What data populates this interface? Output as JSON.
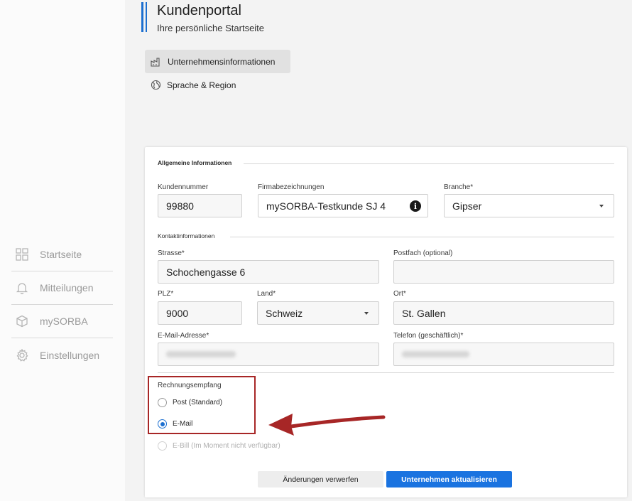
{
  "sidebar": {
    "items": [
      {
        "label": "Startseite",
        "icon": "dashboard-icon"
      },
      {
        "label": "Mitteilungen",
        "icon": "bell-icon"
      },
      {
        "label": "mySORBA",
        "icon": "cube-icon"
      },
      {
        "label": "Einstellungen",
        "icon": "gear-icon"
      }
    ]
  },
  "header": {
    "title": "Kundenportal",
    "subtitle": "Ihre persönliche Startseite"
  },
  "subnav": {
    "items": [
      {
        "label": "Unternehmensinformationen",
        "icon": "factory-icon",
        "active": true
      },
      {
        "label": "Sprache & Region",
        "icon": "globe-icon",
        "active": false
      }
    ]
  },
  "form": {
    "general_section": "Allgemeine Informationen",
    "customer_number_label": "Kundennummer",
    "customer_number_value": "99880",
    "company_label": "Firmabezeichnungen",
    "company_value": "mySORBA-Testkunde SJ 4",
    "industry_label": "Branche*",
    "industry_value": "Gipser",
    "contact_section": "Kontaktinformationen",
    "street_label": "Strasse*",
    "street_value": "Schochengasse 6",
    "pobox_label": "Postfach (optional)",
    "pobox_value": "",
    "zip_label": "PLZ*",
    "zip_value": "9000",
    "country_label": "Land*",
    "country_value": "Schweiz",
    "city_label": "Ort*",
    "city_value": "St. Gallen",
    "email_label": "E-Mail-Adresse*",
    "phone_label": "Telefon (geschäftlich)*",
    "billing_section": "Rechnungsempfang",
    "billing_options": [
      {
        "label": "Post (Standard)",
        "checked": false,
        "disabled": false
      },
      {
        "label": "E-Mail",
        "checked": true,
        "disabled": false
      },
      {
        "label": "E-Bill (Im Moment nicht verfügbar)",
        "checked": false,
        "disabled": true
      }
    ]
  },
  "buttons": {
    "discard": "Änderungen verwerfen",
    "update": "Unternehmen aktualisieren"
  },
  "colors": {
    "accent": "#1a73e0",
    "highlight": "#a72626"
  }
}
